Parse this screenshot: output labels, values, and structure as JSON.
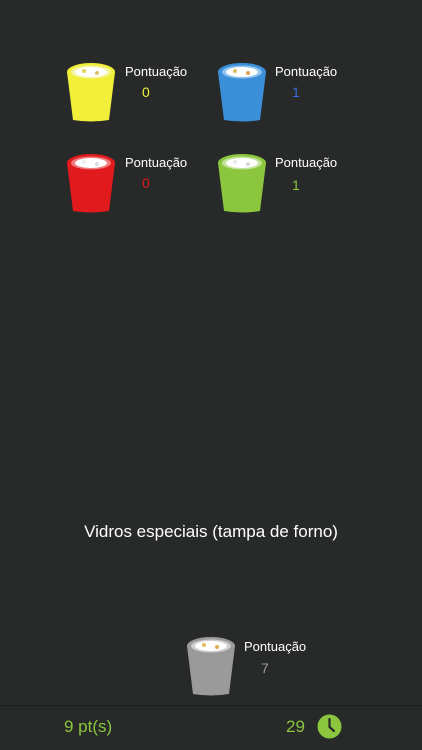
{
  "bins": [
    {
      "id": "yellow",
      "label": "Pontuação",
      "score": "0",
      "color": "#f2ef3b",
      "rim": "#f5f4a0",
      "score_color": "#f2ef3b"
    },
    {
      "id": "blue",
      "label": "Pontuação",
      "score": "1",
      "color": "#3b8fd8",
      "rim": "#8fc2ee",
      "score_color": "#3b6fe0"
    },
    {
      "id": "red",
      "label": "Pontuação",
      "score": "0",
      "color": "#e11a1e",
      "rim": "#f07a7c",
      "score_color": "#e11a1e"
    },
    {
      "id": "green",
      "label": "Pontuação",
      "score": "1",
      "color": "#8cc63f",
      "rim": "#c2e49a",
      "score_color": "#8cc63f"
    }
  ],
  "prompt": "Vidros especiais (tampa de forno)",
  "player_bin": {
    "label": "Pontuação",
    "score": "7",
    "color": "#9a9a9a",
    "rim": "#cfcfcf",
    "score_color": "#9a9a9a"
  },
  "footer": {
    "total_points": "9 pt(s)",
    "timer": "29",
    "timer_icon": "clock-icon",
    "accent": "#8cc63f"
  }
}
